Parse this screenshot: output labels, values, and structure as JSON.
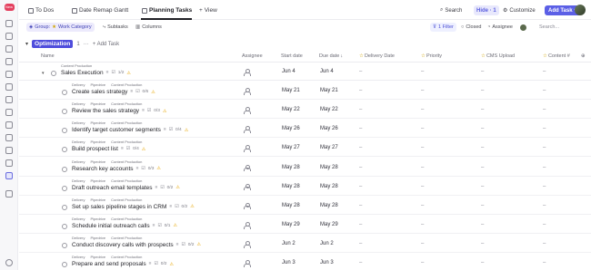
{
  "sidebar": {
    "badge": "New",
    "icons": [
      "home-icon",
      "inbox-icon",
      "docs-icon",
      "dashboards-icon",
      "whiteboards-icon",
      "clips-icon",
      "timesheets-icon",
      "goals-icon",
      "pulse-icon",
      "teams-icon",
      "more-icon",
      "favorites-icon",
      "spaces-icon",
      "new-space-icon",
      "invite-icon"
    ]
  },
  "tabs": [
    {
      "label": "To Dos",
      "active": false
    },
    {
      "label": "Date Remap Gantt",
      "active": false
    },
    {
      "label": "Planning Tasks",
      "active": true
    }
  ],
  "add_view": "View",
  "topbar": {
    "search": "Search",
    "hide": "Hide · 1",
    "customize": "Customize",
    "add_task": "Add Task"
  },
  "toolbar": {
    "group_label": "Group:",
    "group_value": "Work Category",
    "subtasks": "Subtasks",
    "columns": "Columns",
    "filter": "1 Filter",
    "closed": "Closed",
    "assignee": "Assignee",
    "search_placeholder": "Search..."
  },
  "group": {
    "name": "Optimization",
    "count": "1",
    "more": "···",
    "add_task": "Add Task"
  },
  "columns": {
    "name": "Name",
    "assignee": "Assignee",
    "start_date": "Start date",
    "due_date": "Due date",
    "delivery_date": "Delivery Date",
    "priority": "Priority",
    "cms_upload": "CMS Upload",
    "content": "Content #"
  },
  "colors": {
    "accent": "#5b5fe6",
    "group_pill": "#4f4ddc",
    "warning": "#e7a500"
  },
  "tasks": [
    {
      "crumbs": [
        "Content Production"
      ],
      "name": "Sales Execution",
      "meta": "1/2",
      "start": "Jun 4",
      "due": "Jun 4",
      "delivery": "–",
      "priority": "–",
      "cms": "–",
      "content": "–"
    },
    {
      "crumbs": [
        "Delivery",
        "Pipedrive",
        "Content Production"
      ],
      "name": "Create sales strategy",
      "meta": "0/6",
      "start": "May 21",
      "due": "May 21",
      "delivery": "–",
      "priority": "–",
      "cms": "–",
      "content": "–"
    },
    {
      "crumbs": [
        "Delivery",
        "Pipedrive",
        "Content Production"
      ],
      "name": "Review the sales strategy",
      "meta": "0/3",
      "start": "May 22",
      "due": "May 22",
      "delivery": "–",
      "priority": "–",
      "cms": "–",
      "content": "–"
    },
    {
      "crumbs": [
        "Delivery",
        "Pipedrive",
        "Content Production"
      ],
      "name": "Identify target customer segments",
      "meta": "0/4",
      "start": "May 26",
      "due": "May 26",
      "delivery": "–",
      "priority": "–",
      "cms": "–",
      "content": "–"
    },
    {
      "crumbs": [
        "Delivery",
        "Pipedrive",
        "Content Production"
      ],
      "name": "Build prospect list",
      "meta": "0/4",
      "start": "May 27",
      "due": "May 27",
      "delivery": "–",
      "priority": "–",
      "cms": "–",
      "content": "–"
    },
    {
      "crumbs": [
        "Delivery",
        "Pipedrive",
        "Content Production"
      ],
      "name": "Research key accounts",
      "meta": "0/3",
      "start": "May 28",
      "due": "May 28",
      "delivery": "–",
      "priority": "–",
      "cms": "–",
      "content": "–"
    },
    {
      "crumbs": [
        "Delivery",
        "Pipedrive",
        "Content Production"
      ],
      "name": "Draft outreach email templates",
      "meta": "0/2",
      "start": "May 28",
      "due": "May 28",
      "delivery": "–",
      "priority": "–",
      "cms": "–",
      "content": "–"
    },
    {
      "crumbs": [
        "Delivery",
        "Pipedrive",
        "Content Production"
      ],
      "name": "Set up sales pipeline stages in CRM",
      "meta": "0/2",
      "start": "May 28",
      "due": "May 28",
      "delivery": "–",
      "priority": "–",
      "cms": "–",
      "content": "–"
    },
    {
      "crumbs": [
        "Delivery",
        "Pipedrive",
        "Content Production"
      ],
      "name": "Schedule initial outreach calls",
      "meta": "0/1",
      "start": "May 29",
      "due": "May 29",
      "delivery": "–",
      "priority": "–",
      "cms": "–",
      "content": "–"
    },
    {
      "crumbs": [
        "Delivery",
        "Pipedrive",
        "Content Production"
      ],
      "name": "Conduct discovery calls with prospects",
      "meta": "0/2",
      "start": "Jun 2",
      "due": "Jun 2",
      "delivery": "–",
      "priority": "–",
      "cms": "–",
      "content": "–"
    },
    {
      "crumbs": [
        "Delivery",
        "Pipedrive",
        "Content Production"
      ],
      "name": "Prepare and send proposals",
      "meta": "0/2",
      "start": "Jun 3",
      "due": "Jun 3",
      "delivery": "–",
      "priority": "–",
      "cms": "–",
      "content": "–"
    }
  ]
}
